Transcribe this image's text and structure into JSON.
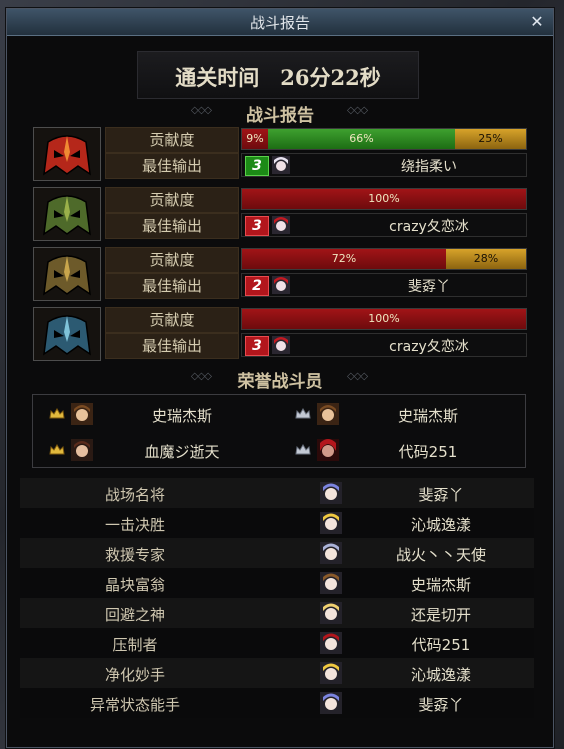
{
  "window": {
    "title": "战斗报告",
    "close_glyph": "✕"
  },
  "clear_time": {
    "text": "通关时间　26分22秒"
  },
  "section_report": {
    "title": "战斗报告",
    "deco": "◇◇◇"
  },
  "labels": {
    "contribution": "贡献度",
    "best_output": "最佳输出"
  },
  "players": [
    {
      "avatar_icon": "red-flame-helmet-icon",
      "contribution": [
        {
          "label": "9%",
          "value": 9,
          "color": "red"
        },
        {
          "label": "66%",
          "value": 66,
          "color": "green"
        },
        {
          "label": "25%",
          "value": 25,
          "color": "gold"
        }
      ],
      "best_rank": "3",
      "best_rank_color": "green",
      "best_name": "绕指柔い"
    },
    {
      "avatar_icon": "green-skull-helmet-icon",
      "contribution": [
        {
          "label": "100%",
          "value": 100,
          "color": "red"
        }
      ],
      "best_rank": "3",
      "best_rank_color": "red",
      "best_name": "crazy夂恋冰"
    },
    {
      "avatar_icon": "gold-skull-helmet-icon",
      "contribution": [
        {
          "label": "72%",
          "value": 72,
          "color": "red"
        },
        {
          "label": "28%",
          "value": 28,
          "color": "gold"
        }
      ],
      "best_rank": "2",
      "best_rank_color": "red",
      "best_name": "斐孬丫"
    },
    {
      "avatar_icon": "blue-skull-helmet-icon",
      "contribution": [
        {
          "label": "100%",
          "value": 100,
          "color": "red"
        }
      ],
      "best_rank": "3",
      "best_rank_color": "red",
      "best_name": "crazy夂恋冰"
    }
  ],
  "section_honor": {
    "title": "荣誉战斗员",
    "deco": "◇◇◇"
  },
  "honor": [
    {
      "icon": "gold-crown-icon",
      "name": "史瑞杰斯"
    },
    {
      "icon": "silver-crown-icon",
      "name": "史瑞杰斯"
    },
    {
      "icon": "gold-crown-icon",
      "name": "血魔ジ逝天"
    },
    {
      "icon": "silver-crown-icon",
      "name": "代码251"
    }
  ],
  "awards": [
    {
      "award": "战场名将",
      "name": "斐孬丫"
    },
    {
      "award": "一击决胜",
      "name": "沁城逸漾"
    },
    {
      "award": "救援专家",
      "name": "战火丶丶天使"
    },
    {
      "award": "晶块富翁",
      "name": "史瑞杰斯"
    },
    {
      "award": "回避之神",
      "name": "还是切开"
    },
    {
      "award": "压制者",
      "name": "代码251"
    },
    {
      "award": "净化妙手",
      "name": "沁城逸漾"
    },
    {
      "award": "异常状态能手",
      "name": "斐孬丫"
    }
  ],
  "colors": {
    "red": "#a11417",
    "green": "#3ea02f",
    "gold": "#d7a32a",
    "accent_text": "#cfc2a2"
  }
}
